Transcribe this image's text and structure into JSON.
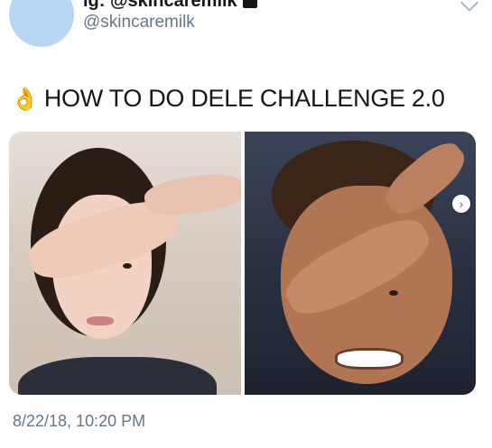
{
  "header": {
    "display_name": "ig: @skincaremilk",
    "handle": "@skincaremilk"
  },
  "tweet": {
    "emoji": "👌",
    "text": "HOW TO DO DELE CHALLENGE 2.0"
  },
  "media": {
    "nav_arrow": "›"
  },
  "timestamp": "8/22/18, 10:20 PM",
  "colors": {
    "avatar": "#b8d6f4",
    "text": "#14171a",
    "secondary_text": "#657786"
  }
}
